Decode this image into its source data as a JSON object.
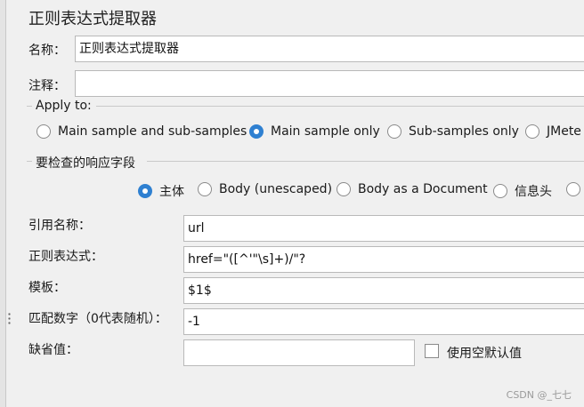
{
  "title": "正则表达式提取器",
  "name_label": "名称：",
  "name_value": "正则表达式提取器",
  "comment_label": "注释：",
  "comment_value": "",
  "apply_to": {
    "label": "Apply to:",
    "options": [
      "Main sample and sub-samples",
      "Main sample only",
      "Sub-samples only",
      "JMete"
    ],
    "selected": 1
  },
  "field_to_check": {
    "label": "要检查的响应字段",
    "options": [
      "主体",
      "Body (unescaped)",
      "Body as a Document",
      "信息头"
    ],
    "selected": 0
  },
  "fields": [
    {
      "label": "引用名称：",
      "value": "url"
    },
    {
      "label": "正则表达式：",
      "value": "href=\"([^'\"\\s]+)/\"?"
    },
    {
      "label": "模板：",
      "value": "$1$"
    },
    {
      "label": "匹配数字（0代表随机）：",
      "value": "-1"
    },
    {
      "label": "缺省值：",
      "value": ""
    }
  ],
  "use_empty_default": {
    "label": "使用空默认值",
    "checked": false
  },
  "watermark": "CSDN @_七七",
  "colors": {
    "radio_selected": "#2f80d1",
    "background": "#f0f0f0"
  },
  "icons": {
    "splitter_grip": "grip-dots-icon"
  }
}
